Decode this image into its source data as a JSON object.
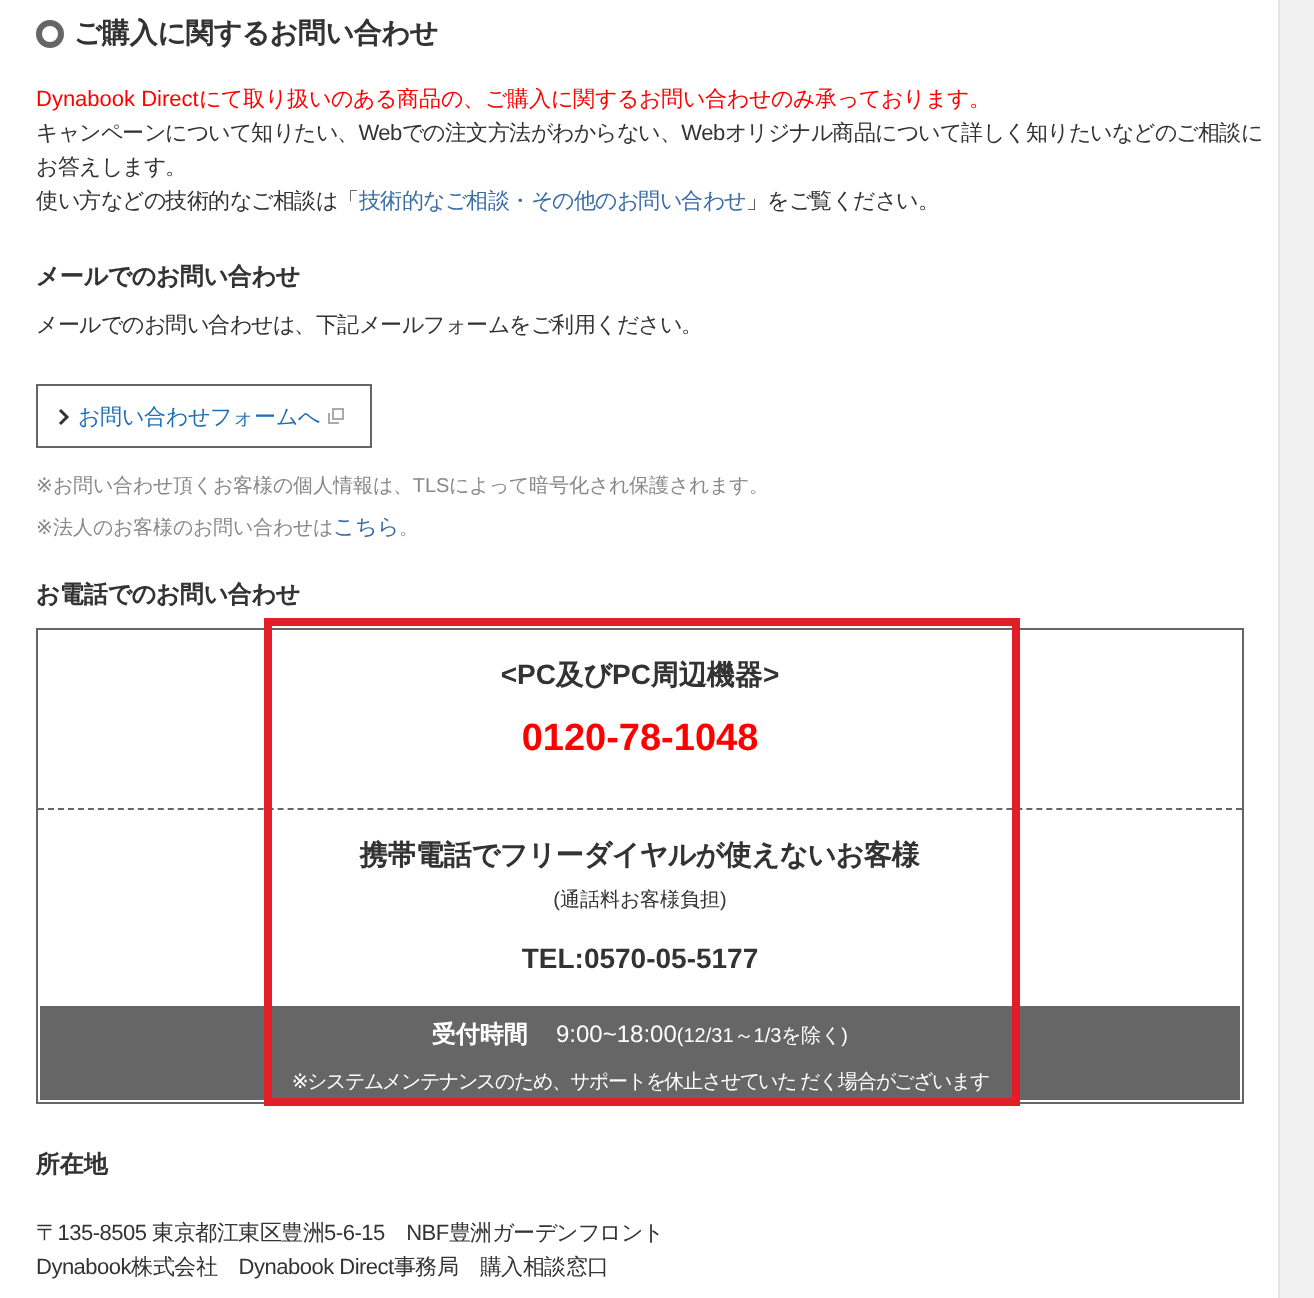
{
  "section_title": "ご購入に関するお問い合わせ",
  "intro": {
    "notice": "Dynabook Directにて取り扱いのある商品の、ご購入に関するお問い合わせのみ承っております。",
    "body": "キャンペーンについて知りたい、Webでの注文方法がわからない、Webオリジナル商品について詳しく知りたいなどのご相談にお答えします。",
    "tech_before": "使い方などの技術的なご相談は「",
    "tech_link": "技術的なご相談・その他のお問い合わせ",
    "tech_after": "」をご覧ください。"
  },
  "mail": {
    "heading": "メールでのお問い合わせ",
    "text": "メールでのお問い合わせは、下記メールフォームをご利用ください。",
    "button": "お問い合わせフォームへ",
    "note_1": "※お問い合わせ頂くお客様の個人情報は、TLSによって暗号化され保護されます。",
    "note_2_before": "※法人のお客様のお問い合わせは",
    "note_2_link": "こちら",
    "note_2_after": "。"
  },
  "phone": {
    "heading": "お電話でのお問い合わせ",
    "category": "<PC及びPC周辺機器>",
    "free_dial": "0120-78-1048",
    "mobile_heading": "携帯電話でフリーダイヤルが使えないお客様",
    "mobile_note": "(通話料お客様負担)",
    "mobile_tel": "TEL:0570-05-5177",
    "hours_label": "受付時間",
    "hours": "9:00~18:00",
    "hours_note": "(12/31～1/3を除く)",
    "maintenance": "※システムメンテナンスのため、サポートを休止させていた だく場合がございます"
  },
  "address": {
    "heading": "所在地",
    "line_1": "〒135-8505 東京都江東区豊洲5-6-15　NBF豊洲ガーデンフロント",
    "line_2": "Dynabook株式会社　Dynabook Direct事務局　購入相談窓口"
  }
}
